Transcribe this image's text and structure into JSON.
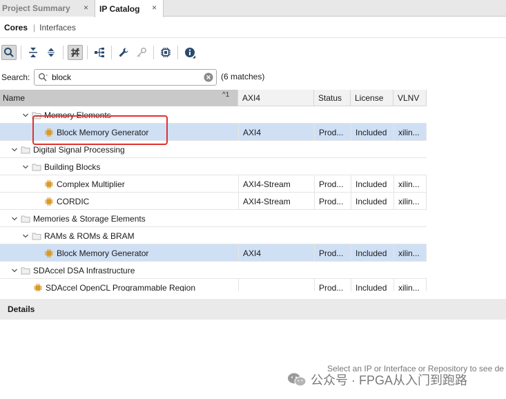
{
  "tabs": [
    {
      "label": "Project Summary",
      "active": false,
      "close": "×"
    },
    {
      "label": "IP Catalog",
      "active": true,
      "close": "×"
    }
  ],
  "subtabs": {
    "cores": "Cores",
    "separator": "|",
    "interfaces": "Interfaces"
  },
  "toolbar": {
    "icons": [
      "search-icon",
      "collapse-all-icon",
      "expand-all-icon",
      "filter-icon",
      "hierarchy-icon",
      "wrench-icon",
      "key-icon",
      "chip-icon",
      "info-icon"
    ]
  },
  "search": {
    "label": "Search:",
    "value": "block",
    "matches": "(6 matches)"
  },
  "table": {
    "headers": {
      "name": "Name",
      "sort": "^1",
      "axi": "AXI4",
      "status": "Status",
      "license": "License",
      "vlnv": "VLNV"
    },
    "rows": [
      {
        "name": "Memory Elements",
        "type": "folder",
        "level": 2,
        "expanded": true,
        "axi": "",
        "status": "",
        "license": "",
        "vlnv": ""
      },
      {
        "name": "Block Memory Generator",
        "type": "ip",
        "level": 3,
        "selected": true,
        "axi": "AXI4",
        "status": "Prod...",
        "license": "Included",
        "vlnv": "xilin..."
      },
      {
        "name": "Digital Signal Processing",
        "type": "folder",
        "level": 1,
        "expanded": true,
        "axi": "",
        "status": "",
        "license": "",
        "vlnv": ""
      },
      {
        "name": "Building Blocks",
        "type": "folder",
        "level": 2,
        "expanded": true,
        "axi": "",
        "status": "",
        "license": "",
        "vlnv": ""
      },
      {
        "name": "Complex Multiplier",
        "type": "ip",
        "level": 3,
        "axi": "AXI4-Stream",
        "status": "Prod...",
        "license": "Included",
        "vlnv": "xilin..."
      },
      {
        "name": "CORDIC",
        "type": "ip",
        "level": 3,
        "axi": "AXI4-Stream",
        "status": "Prod...",
        "license": "Included",
        "vlnv": "xilin..."
      },
      {
        "name": "Memories & Storage Elements",
        "type": "folder",
        "level": 1,
        "expanded": true,
        "axi": "",
        "status": "",
        "license": "",
        "vlnv": ""
      },
      {
        "name": "RAMs & ROMs & BRAM",
        "type": "folder",
        "level": 2,
        "expanded": true,
        "axi": "",
        "status": "",
        "license": "",
        "vlnv": ""
      },
      {
        "name": "Block Memory Generator",
        "type": "ip",
        "level": 3,
        "selected": true,
        "axi": "AXI4",
        "status": "Prod...",
        "license": "Included",
        "vlnv": "xilin..."
      },
      {
        "name": "SDAccel DSA Infrastructure",
        "type": "folder",
        "level": 1,
        "expanded": true,
        "axi": "",
        "status": "",
        "license": "",
        "vlnv": ""
      },
      {
        "name": "SDAccel OpenCL Programmable Region",
        "type": "ip",
        "level": 2,
        "axi": "",
        "status": "Prod...",
        "license": "Included",
        "vlnv": "xilin..."
      }
    ]
  },
  "details": {
    "title": "Details",
    "hint": "Select an IP or Interface or Repository to see de"
  },
  "watermark": {
    "text": "公众号 · FPGA从入门到跑路"
  },
  "colors": {
    "selected_row": "#cfe0f5",
    "highlight": "#e03030",
    "ip_icon": "#d89a28"
  }
}
